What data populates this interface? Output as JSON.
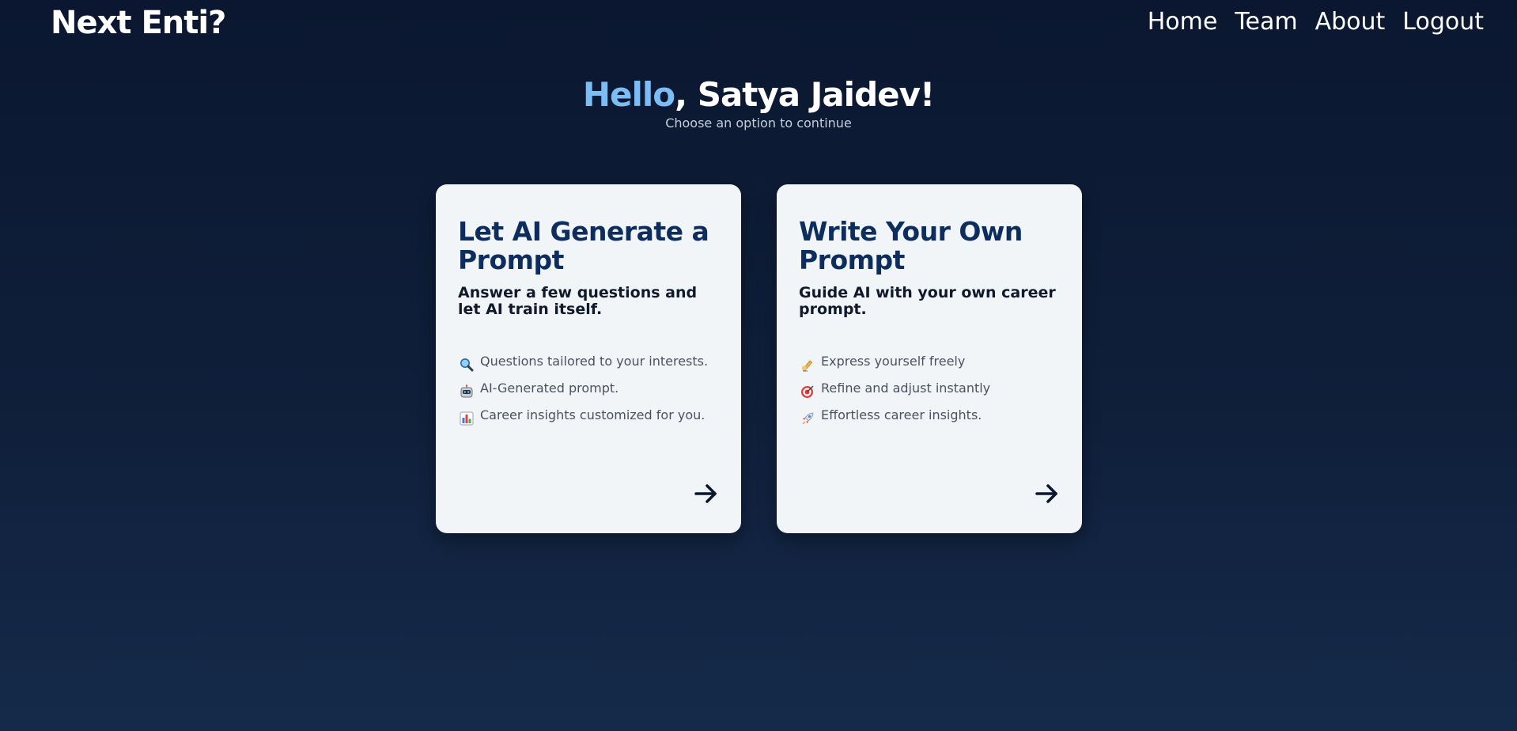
{
  "header": {
    "brand": "Next Enti?",
    "nav": [
      "Home",
      "Team",
      "About",
      "Logout"
    ]
  },
  "greeting": {
    "accent": "Hello",
    "rest": ", Satya Jaidev!",
    "subtitle": "Choose an option to continue",
    "accent_color": "#7dbdf5"
  },
  "cards": [
    {
      "title": "Let AI Generate a Prompt",
      "description": "Answer a few questions and let AI train itself.",
      "features": [
        {
          "icon": "magnifier-icon",
          "text": "Questions tailored to your interests."
        },
        {
          "icon": "robot-icon",
          "text": "AI-Generated prompt."
        },
        {
          "icon": "bar-chart-icon",
          "text": "Career insights customized for you."
        }
      ],
      "action_icon": "arrow-right-icon"
    },
    {
      "title": "Write Your Own Prompt",
      "description": "Guide AI with your own career prompt.",
      "features": [
        {
          "icon": "writing-hand-icon",
          "text": "Express yourself freely"
        },
        {
          "icon": "target-icon",
          "text": "Refine and adjust instantly"
        },
        {
          "icon": "rocket-icon",
          "text": "Effortless career insights."
        }
      ],
      "action_icon": "arrow-right-icon"
    }
  ],
  "colors": {
    "background_top": "#0b1730",
    "background_bottom": "#152a4a",
    "card_background": "#f1f5f8",
    "card_title": "#0c2d5e"
  }
}
